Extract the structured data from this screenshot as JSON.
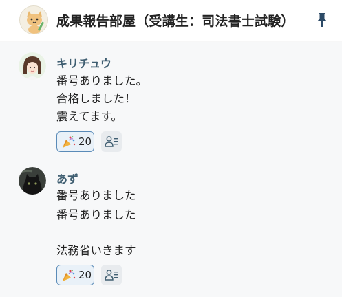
{
  "header": {
    "title": "成果報告部屋（受講生：司法書士試験）"
  },
  "messages": [
    {
      "author": "キリチュウ",
      "lines": [
        "番号ありました。",
        "合格しました！",
        "震えてます。"
      ],
      "reaction_count": "20"
    },
    {
      "author": "あず",
      "lines": [
        "番号ありました",
        "番号ありました",
        "",
        "法務省いきます"
      ],
      "reaction_count": "20"
    }
  ],
  "colors": {
    "author_name": "#3f5e71",
    "reaction_border": "#5a8bb8",
    "reaction_bg": "#e9f1f8"
  }
}
